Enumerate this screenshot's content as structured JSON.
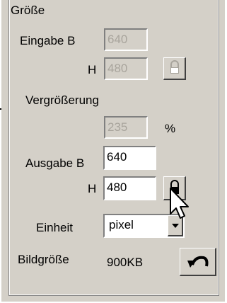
{
  "group_title": "Größe",
  "input": {
    "width_label": "Eingabe B",
    "width_value": "640",
    "height_label": "H",
    "height_value": "480"
  },
  "magnification": {
    "label": "Vergrößerung",
    "value": "235",
    "unit": "%"
  },
  "output": {
    "width_label": "Ausgabe B",
    "width_value": "640",
    "height_label": "H",
    "height_value": "480"
  },
  "unit": {
    "label": "Einheit",
    "selected": "pixel"
  },
  "image_size": {
    "label": "Bildgröße",
    "value": "900KB"
  },
  "colors": {
    "panel": "#d4d0c8",
    "disabled_text": "#a8a49c"
  },
  "icons": [
    "lock-icon",
    "padlock-icon",
    "chevron-down-icon",
    "undo-arrow-icon",
    "mouse-pointer-icon"
  ]
}
